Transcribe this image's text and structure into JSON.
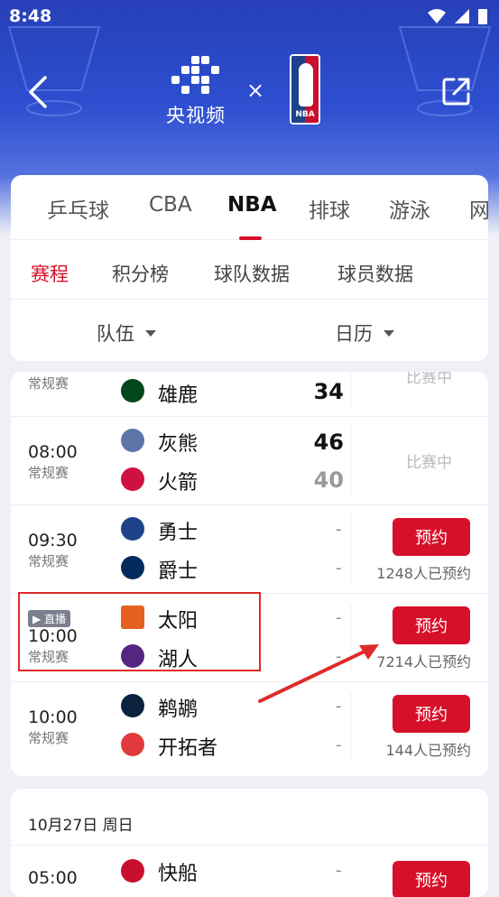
{
  "status_bar": {
    "time": "8:48"
  },
  "header": {
    "brand_text": "央视频",
    "times_sign": "×",
    "partner_logo_text": "NBA"
  },
  "sport_tabs": [
    {
      "label": "乒乓球",
      "active": false
    },
    {
      "label": "CBA",
      "active": false
    },
    {
      "label": "NBA",
      "active": true
    },
    {
      "label": "排球",
      "active": false
    },
    {
      "label": "游泳",
      "active": false
    },
    {
      "label": "网",
      "active": false
    }
  ],
  "sub_tabs": [
    {
      "label": "赛程",
      "active": true
    },
    {
      "label": "积分榜",
      "active": false
    },
    {
      "label": "球队数据",
      "active": false
    },
    {
      "label": "球员数据",
      "active": false
    }
  ],
  "filters": {
    "team": "队伍",
    "calendar": "日历"
  },
  "matches": [
    {
      "time": "",
      "type": "常规赛",
      "live": false,
      "teams": [
        {
          "name": "雄鹿",
          "score": "34",
          "logo_color": "#00471b"
        }
      ],
      "status": "比赛中",
      "action": null
    },
    {
      "time": "08:00",
      "type": "常规赛",
      "live": false,
      "teams": [
        {
          "name": "灰熊",
          "score": "46",
          "logo_color": "#5d76a9"
        },
        {
          "name": "火箭",
          "score": "40",
          "logo_color": "#ce1141"
        }
      ],
      "status": "比赛中",
      "action": null
    },
    {
      "time": "09:30",
      "type": "常规赛",
      "live": false,
      "teams": [
        {
          "name": "勇士",
          "score": "-",
          "logo_color": "#1d428a"
        },
        {
          "name": "爵士",
          "score": "-",
          "logo_color": "#002b5c"
        }
      ],
      "action": "预约",
      "booked": "1248人已预约"
    },
    {
      "time": "10:00",
      "type": "常规赛",
      "live": true,
      "live_label": "▶ 直播",
      "teams": [
        {
          "name": "太阳",
          "score": "-",
          "logo_color": "#e56020"
        },
        {
          "name": "湖人",
          "score": "-",
          "logo_color": "#552583"
        }
      ],
      "action": "预约",
      "booked": "7214人已预约"
    },
    {
      "time": "10:00",
      "type": "常规赛",
      "live": false,
      "teams": [
        {
          "name": "鹈鹕",
          "score": "-",
          "logo_color": "#0c2340"
        },
        {
          "name": "开拓者",
          "score": "-",
          "logo_color": "#e03a3e"
        }
      ],
      "action": "预约",
      "booked": "144人已预约"
    }
  ],
  "next_date": {
    "header": "10月27日 周日",
    "first_match": {
      "time": "05:00",
      "team": "快船",
      "score": "-",
      "logo_color": "#c8102e",
      "action": "预约"
    }
  },
  "colors": {
    "accent": "#d7102a",
    "header_blue": "#2d4fd0"
  }
}
